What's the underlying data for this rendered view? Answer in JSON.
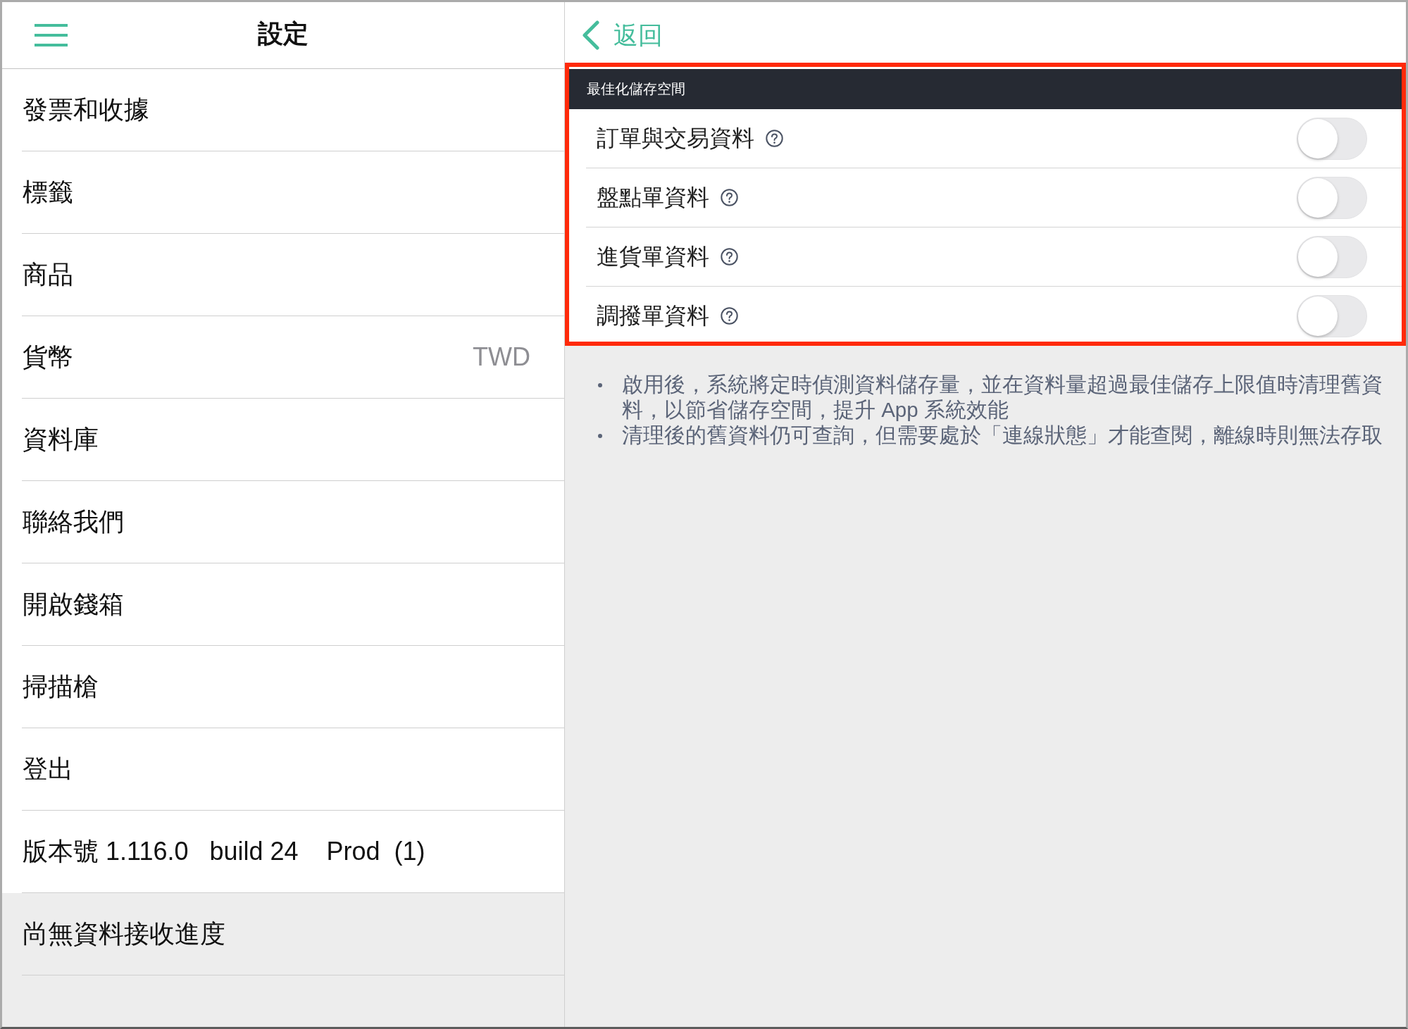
{
  "sidebar": {
    "title": "設定",
    "items": [
      {
        "kind": "item",
        "label": "發票和收據"
      },
      {
        "kind": "item",
        "label": "標籤"
      },
      {
        "kind": "item",
        "label": "商品"
      },
      {
        "kind": "item",
        "label": "貨幣",
        "value": "TWD"
      },
      {
        "kind": "item",
        "label": "資料庫"
      },
      {
        "kind": "item",
        "label": "聯絡我們"
      },
      {
        "kind": "item",
        "label": "開啟錢箱"
      },
      {
        "kind": "item",
        "label": "掃描槍"
      },
      {
        "kind": "item",
        "label": "登出"
      },
      {
        "kind": "item",
        "label": "版本號 1.116.0   build 24    Prod  (1)"
      },
      {
        "kind": "status",
        "label": "尚無資料接收進度"
      }
    ]
  },
  "detail": {
    "back": "返回",
    "section": {
      "title": "最佳化儲存空間",
      "highlighted": true,
      "options": [
        {
          "label": "訂單與交易資料",
          "on": false
        },
        {
          "label": "盤點單資料",
          "on": false
        },
        {
          "label": "進貨單資料",
          "on": false
        },
        {
          "label": "調撥單資料",
          "on": false
        }
      ]
    },
    "notes": [
      "啟用後，系統將定時偵測資料儲存量，並在資料量超過最佳儲存上限值時清理舊資料，以節省儲存空間，提升 App 系統效能",
      "清理後的舊資料仍可查詢，但需要處於「連線狀態」才能查閱，離線時則無法存取"
    ]
  }
}
